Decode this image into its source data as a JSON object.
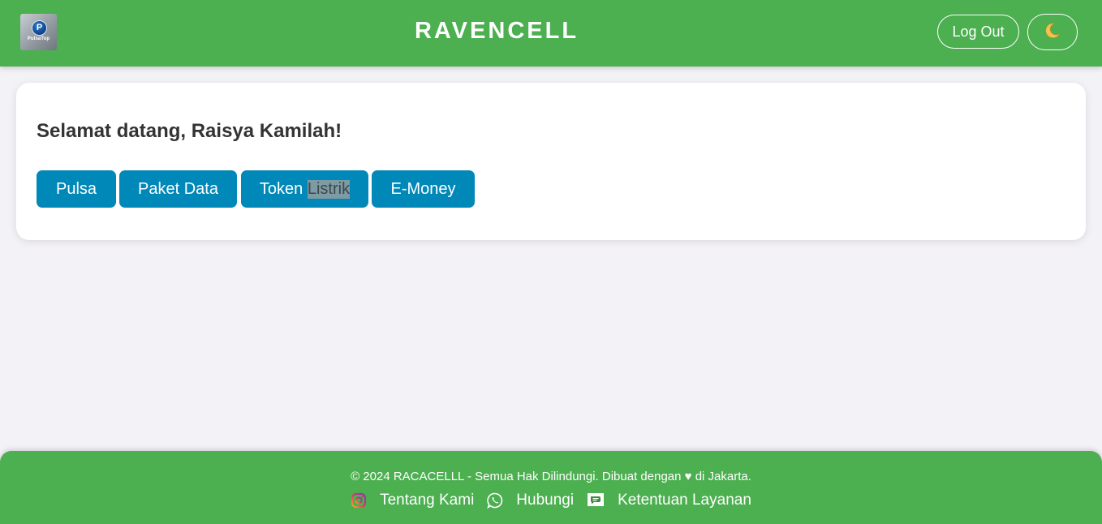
{
  "header": {
    "logo_text": "PulsaTop",
    "logo_letter": "P",
    "brand": "RAVENCELL",
    "logout_label": "Log Out",
    "theme_icon": "moon-icon"
  },
  "main": {
    "welcome": "Selamat datang, Raisya Kamilah!",
    "services": [
      {
        "label": "Pulsa"
      },
      {
        "label": "Paket Data"
      },
      {
        "label_a": "Token",
        "label_b": "Listrik"
      },
      {
        "label": "E-Money"
      }
    ]
  },
  "footer": {
    "copyright": "© 2024 RACACELLL - Semua Hak Dilindungi. Dibuat dengan ♥ di Jakarta.",
    "links": [
      {
        "label": "Tentang Kami",
        "icon": "instagram-icon"
      },
      {
        "label": "Hubungi",
        "icon": "whatsapp-icon"
      },
      {
        "label": "Ketentuan Layanan",
        "icon": "chat-document-icon"
      }
    ]
  },
  "colors": {
    "primary_green": "#4caf50",
    "button_blue": "#0088b8",
    "background": "#f3f2f7"
  }
}
